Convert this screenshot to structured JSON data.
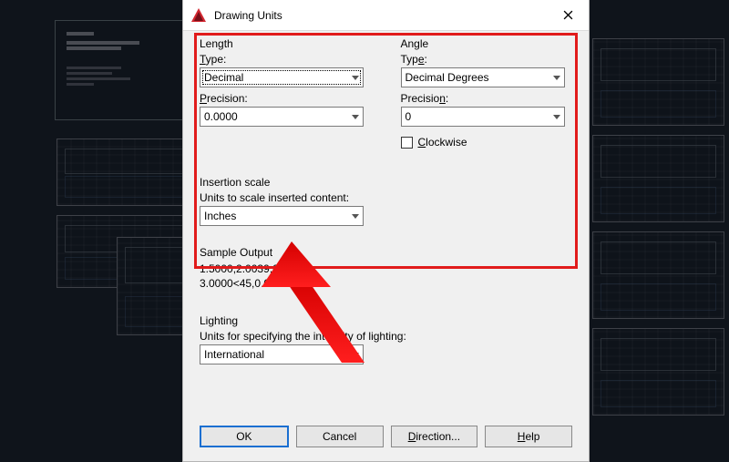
{
  "dialog": {
    "title": "Drawing Units"
  },
  "length": {
    "heading": "Length",
    "type_label_pre": "T",
    "type_label_rest": "ype:",
    "type_value": "Decimal",
    "precision_label_pre": "P",
    "precision_label_rest": "recision:",
    "precision_value": "0.0000"
  },
  "angle": {
    "heading": "Angle",
    "type_label_pre": "Typ",
    "type_label_u": "e",
    "type_label_post": ":",
    "type_value": "Decimal Degrees",
    "precision_label_pre": "Precisio",
    "precision_label_u": "n",
    "precision_label_post": ":",
    "precision_value": "0",
    "clockwise_pre": "",
    "clockwise_u": "C",
    "clockwise_rest": "lockwise"
  },
  "insertion": {
    "heading": "Insertion scale",
    "label": "Units to scale inserted content:",
    "value": "Inches"
  },
  "sample": {
    "heading": "Sample Output",
    "line1": "1.5000,2.0039,0.0000",
    "line2": "3.0000<45,0.0000"
  },
  "lighting": {
    "heading": "Lighting",
    "label": "Units for specifying the intensity of lighting:",
    "value": "International"
  },
  "buttons": {
    "ok": "OK",
    "cancel": "Cancel",
    "direction_pre": "",
    "direction_u": "D",
    "direction_rest": "irection...",
    "help_pre": "",
    "help_u": "H",
    "help_rest": "elp"
  }
}
